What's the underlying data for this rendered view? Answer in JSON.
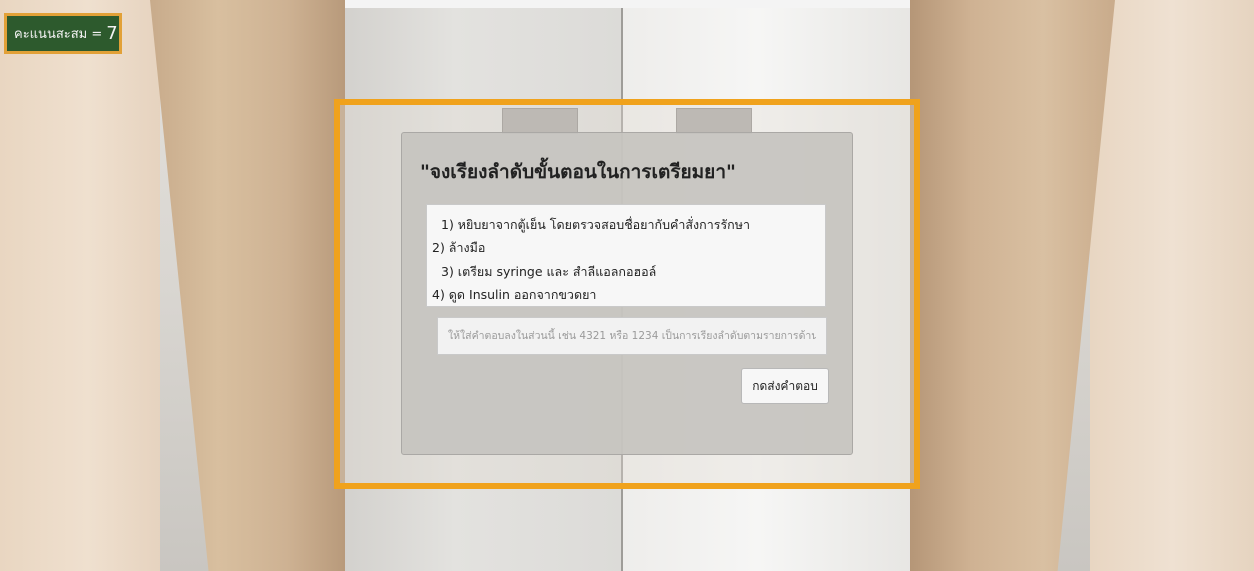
{
  "hud": {
    "score_label": "คะแนนสะสม =",
    "score_value": "7"
  },
  "question": {
    "title": "\"จงเรียงลำดับขั้นตอนในการเตรียมยา\"",
    "options": [
      "1) หยิบยาจากตู้เย็น โดยตรวจสอบชื่อยากับคำสั่งการรักษา",
      "2) ล้างมือ",
      "3) เตรียม syringe และ สำลีแอลกอฮอล์",
      "4) ดูด Insulin ออกจากขวดยา"
    ],
    "answer_value": "",
    "answer_placeholder": "ให้ใส่คำตอบลงในส่วนนี้ เช่น 4321 หรือ 1234 เป็นการเรียงลำดับตามรายการด้านบน",
    "submit_label": "กดส่งคำตอบ"
  },
  "colors": {
    "score_bg": "#2d5a2d",
    "score_border": "#e2a137",
    "frame_accent": "#f0a21c"
  }
}
